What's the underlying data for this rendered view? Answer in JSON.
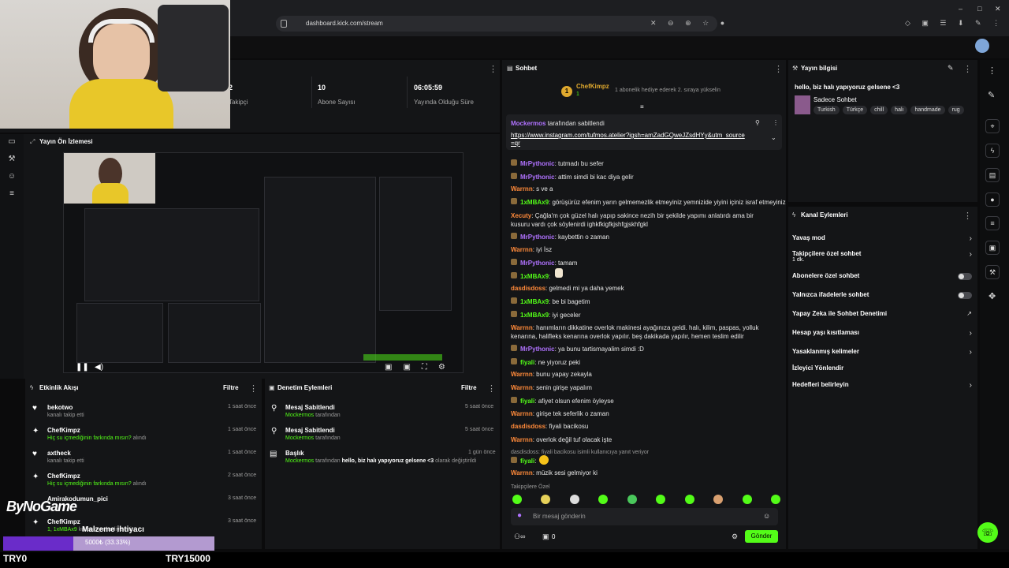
{
  "browser": {
    "url": "dashboard.kick.com/stream"
  },
  "stats": [
    {
      "value": "2",
      "label": "Takipçi"
    },
    {
      "value": "10",
      "label": "Abone Sayısı"
    },
    {
      "value": "06:05:59",
      "label": "Yayında Olduğu Süre"
    }
  ],
  "preview": {
    "title": "Yayın Ön İzlemesi"
  },
  "activity": {
    "title": "Etkinlik Akışı",
    "filter": "Filtre",
    "items": [
      {
        "user": "bekotwo",
        "text": "kanalı takip etti",
        "time": "1 saat önce"
      },
      {
        "user": "ChefKimpz",
        "text": "Hiç su içmediğinin farkında mısın?",
        "suffix": "alındı",
        "time": "1 saat önce"
      },
      {
        "user": "axtheck",
        "text": "kanalı takip etti",
        "time": "1 saat önce"
      },
      {
        "user": "ChefKimpz",
        "text": "Hiç su içmediğinin farkında mısın?",
        "suffix": "alındı",
        "time": "2 saat önce"
      },
      {
        "user": "Amirakodumun_pici",
        "text": "",
        "time": "3 saat önce"
      },
      {
        "user": "ChefKimpz",
        "text": "1, 1xMBAx9",
        "suffix": "kullanıcıya hediye etti.",
        "time": "3 saat önce"
      }
    ]
  },
  "mod": {
    "title": "Denetim Eylemleri",
    "filter": "Filtre",
    "items": [
      {
        "title": "Mesaj Sabitlendi",
        "user": "Mockermos",
        "text": "tarafından",
        "time": "5 saat önce"
      },
      {
        "title": "Mesaj Sabitlendi",
        "user": "Mockermos",
        "text": "tarafından",
        "time": "5 saat önce"
      },
      {
        "title": "Başlık",
        "user": "Mockermos",
        "text": "tarafından",
        "bold": "hello, biz halı yapıyoruz gelsene <3",
        "suffix": "olarak değiştirildi",
        "time": "1 gün önce"
      }
    ]
  },
  "chat": {
    "title": "Sohbet",
    "gift_user": "ChefKimpz",
    "gift_count": "1",
    "gift_text": "1 abonelik hediye ederek 2. sıraya yükselin",
    "pinned_by": "Mockermos",
    "pinned_suffix": "tarafından sabitlendi",
    "pinned_link": "https://www.instagram.com/tufmos.atelier?igsh=amZadGQweJZsdHYy&utm_source=qr",
    "messages": [
      {
        "user": "MrPythonic",
        "color": "purple",
        "text": "tutmadı bu sefer"
      },
      {
        "user": "MrPythonic",
        "color": "purple",
        "text": "attim simdi bi kac diya gelir"
      },
      {
        "user": "Warrnn",
        "color": "orange",
        "text": "s ve a"
      },
      {
        "user": "1xMBAx9",
        "color": "green",
        "text": "görüşürüz efenim yarın gelmemezlik etmeyiniz yemnizide yiyini içiniz israf etmeyiniz"
      },
      {
        "user": "Xecuty",
        "color": "orange",
        "text": "Çağla'm çok güzel halı yapıp sakince nezih bir şekilde yapımı anlatırdı ama bir kusuru vardı çok söylenirdi ighkfkigfkjshfgjskhfgkl"
      },
      {
        "user": "MrPythonic",
        "color": "purple",
        "text": "kaybettin o zaman"
      },
      {
        "user": "Warrnn",
        "color": "orange",
        "text": "iyi İsz"
      },
      {
        "user": "MrPythonic",
        "color": "purple",
        "text": "tamam"
      },
      {
        "user": "1xMBAx9",
        "color": "green",
        "text": ""
      },
      {
        "user": "dasdisdoss",
        "color": "orange",
        "text": "gelmedi mi ya daha yemek"
      },
      {
        "user": "1xMBAx9",
        "color": "green",
        "text": "be bi bagetim"
      },
      {
        "user": "1xMBAx9",
        "color": "green",
        "text": "iyi geceler"
      },
      {
        "user": "Warrnn",
        "color": "orange",
        "text": "hanımların dikkatine overlok makinesi ayağınıza geldi. halı, kilim, paspas, yolluk kenarına, halifleks kenarına overlok yapılır. beş dakikada yapılır, hemen teslim edilir"
      },
      {
        "user": "MrPythonic",
        "color": "purple",
        "text": "ya bunu tartismayalim simdi :D"
      },
      {
        "user": "fiyali",
        "color": "green",
        "text": "ne yiyoruz peki"
      },
      {
        "user": "Warrnn",
        "color": "orange",
        "text": "bunu yapay zekayla"
      },
      {
        "user": "Warrnn",
        "color": "orange",
        "text": "senin girişe yapalım"
      },
      {
        "user": "fiyali",
        "color": "green",
        "text": "afiyet olsun efenim öyleyse"
      },
      {
        "user": "Warrnn",
        "color": "orange",
        "text": "girişe tek seferlik o zaman"
      },
      {
        "user": "dasdisdoss",
        "color": "orange",
        "text": "fiyali bacikosu"
      },
      {
        "user": "Warrnn",
        "color": "orange",
        "text": "overlok değil tuf olacak işte"
      },
      {
        "user": "fiyali",
        "color": "green",
        "text": ""
      },
      {
        "user": "Warrnn",
        "color": "orange",
        "text": "müzik sesi gelmiyor ki"
      }
    ],
    "reply_note": "dasdisdoss: fiyali bacikosu isimli kullanıcıya yanıt veriyor",
    "emote_label": "Takipçilere Özel",
    "input_placeholder": "Bir mesaj gönderin",
    "count": "0",
    "send": "Gönder"
  },
  "info": {
    "title": "Yayın bilgisi",
    "stream_title": "hello, biz halı yapıyoruz gelsene <3",
    "category": "Sadece Sohbet",
    "tags": [
      "Turkish",
      "Türkçe",
      "chill",
      "halı",
      "handmade",
      "rug"
    ]
  },
  "events": {
    "title": "Kanal Eylemleri",
    "items": [
      {
        "label": "Yavaş mod",
        "sub": "",
        "control": "arrow"
      },
      {
        "label": "Takipçilere özel sohbet",
        "sub": "1 dk.",
        "control": "arrow"
      },
      {
        "label": "Abonelere özel sohbet",
        "sub": "",
        "control": "toggle"
      },
      {
        "label": "Yalnızca ifadelerle sohbet",
        "sub": "",
        "control": "toggle"
      },
      {
        "label": "Yapay Zeka ile Sohbet Denetimi",
        "sub": "",
        "control": "link"
      },
      {
        "label": "Hesap yaşı kısıtlaması",
        "sub": "",
        "control": "arrow"
      },
      {
        "label": "Yasaklanmış kelimeler",
        "sub": "",
        "control": "arrow"
      },
      {
        "label": "İzleyici Yönlendir",
        "sub": "",
        "control": "none"
      },
      {
        "label": "Hedefleri belirleyin",
        "sub": "",
        "control": "arrow"
      }
    ]
  },
  "overlay": {
    "logo": "ByNoGame",
    "goal_title": "Malzeme ihtiyacı",
    "goal_progress": "5000₺ (33.33%)",
    "goal_fraction": 0.3333,
    "min": "TRY0",
    "max": "TRY15000"
  }
}
